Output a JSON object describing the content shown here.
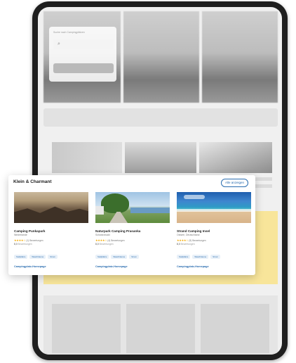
{
  "background": {
    "search_label": "Suche nach Campingplätzen",
    "search_icon": "search-icon"
  },
  "card": {
    "title": "Klein & Charmant",
    "show_all_label": "Alle anzeigen",
    "items": [
      {
        "name": "Camping Punkapark",
        "subtitle": "Niederlande",
        "stars": "★★★★☆",
        "rating_text": "(1) Bewertungen",
        "meta_main": "8,0",
        "meta_dim": "Bewertungen",
        "tags": [
          "Stellplätze",
          "Waschräume",
          "Strom"
        ],
        "link": "Campingplatz-Homepage"
      },
      {
        "name": "Naturpark Camping Prasanka",
        "subtitle": "Schwarzwald",
        "stars": "★★★★☆",
        "rating_text": "(4) Bewertungen",
        "meta_main": "8,0",
        "meta_dim": "Bewertungen",
        "tags": [
          "Stellplätze",
          "Waschräume",
          "Strom"
        ],
        "link": "Campingplatz-Homepage"
      },
      {
        "name": "Strand Camping Insel",
        "subtitle": "Ostsee, Deutschland",
        "stars": "★★★★☆",
        "rating_text": "(9) Bewertungen",
        "meta_main": "8,0",
        "meta_dim": "Bewertungen",
        "tags": [
          "Stellplätze",
          "Waschräume",
          "Strom"
        ],
        "link": "Campingplatz-Homepage"
      }
    ]
  },
  "colors": {
    "accent": "#2a6db0",
    "highlight_band": "#f8e59a",
    "star": "#f2a900"
  }
}
